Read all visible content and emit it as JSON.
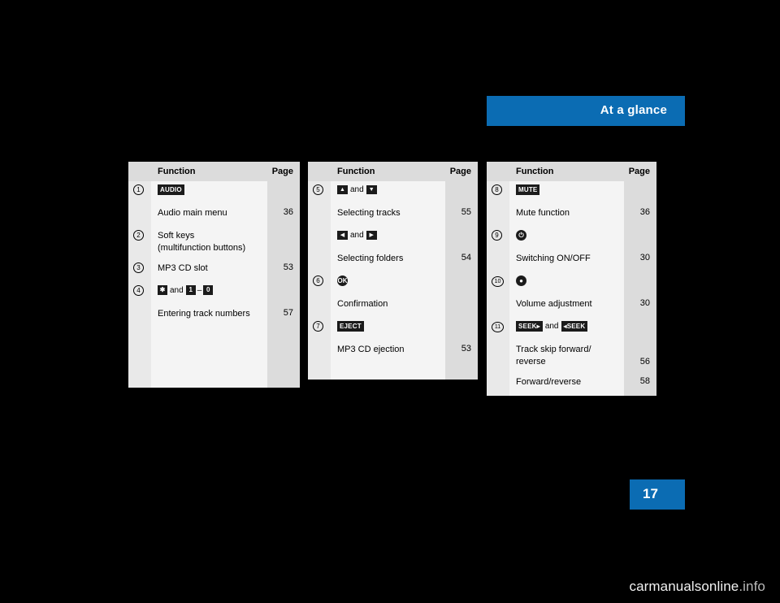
{
  "header": {
    "title": "At a glance",
    "accent_color": "#0b6cb3"
  },
  "page": {
    "number": "17",
    "background": "#000000"
  },
  "watermark": {
    "main": "carmanualsonline",
    "suffix": ".info"
  },
  "tables": [
    {
      "id": "table-1",
      "head": {
        "function": "Function",
        "page": "Page"
      },
      "rows": [
        {
          "num": "1",
          "lines": [
            {
              "type": "key",
              "key": "AUDIO"
            }
          ],
          "page": ""
        },
        {
          "num": "",
          "lines": [
            {
              "type": "text",
              "text": "Audio main menu"
            }
          ],
          "page": "36"
        },
        {
          "num": "2",
          "lines": [
            {
              "type": "text",
              "text": "Soft keys"
            },
            {
              "type": "text",
              "text": "(multifunction buttons)"
            }
          ],
          "page": ""
        },
        {
          "num": "3",
          "lines": [
            {
              "type": "text",
              "text": "MP3 CD slot"
            }
          ],
          "page": "53"
        },
        {
          "num": "4",
          "lines": [
            {
              "type": "keys",
              "a": "✱",
              "join": "and",
              "b": "1",
              "dash": "–",
              "c": "0"
            }
          ],
          "page": ""
        },
        {
          "num": "",
          "lines": [
            {
              "type": "text",
              "text": "Entering track numbers"
            }
          ],
          "page": "57"
        }
      ]
    },
    {
      "id": "table-2",
      "head": {
        "function": "Function",
        "page": "Page"
      },
      "rows": [
        {
          "num": "5",
          "lines": [
            {
              "type": "keys",
              "a": "▲",
              "join": "and",
              "b": "▼"
            }
          ],
          "page": ""
        },
        {
          "num": "",
          "lines": [
            {
              "type": "text",
              "text": "Selecting tracks"
            }
          ],
          "page": "55"
        },
        {
          "num": "",
          "lines": [
            {
              "type": "keys",
              "a": "◀",
              "join": "and",
              "b": "▶"
            }
          ],
          "page": ""
        },
        {
          "num": "",
          "lines": [
            {
              "type": "text",
              "text": "Selecting folders"
            }
          ],
          "page": "54"
        },
        {
          "num": "6",
          "lines": [
            {
              "type": "key-round",
              "key": "OK"
            }
          ],
          "page": ""
        },
        {
          "num": "",
          "lines": [
            {
              "type": "text",
              "text": "Confirmation"
            }
          ],
          "page": ""
        },
        {
          "num": "7",
          "lines": [
            {
              "type": "key",
              "key": "EJECT"
            }
          ],
          "page": ""
        },
        {
          "num": "",
          "lines": [
            {
              "type": "text",
              "text": "MP3 CD ejection"
            }
          ],
          "page": "53"
        }
      ]
    },
    {
      "id": "table-3",
      "head": {
        "function": "Function",
        "page": "Page"
      },
      "rows": [
        {
          "num": "8",
          "lines": [
            {
              "type": "key",
              "key": "MUTE"
            }
          ],
          "page": ""
        },
        {
          "num": "",
          "lines": [
            {
              "type": "text",
              "text": "Mute function"
            }
          ],
          "page": "36"
        },
        {
          "num": "9",
          "lines": [
            {
              "type": "key-round",
              "key": "⏻"
            }
          ],
          "page": ""
        },
        {
          "num": "",
          "lines": [
            {
              "type": "text",
              "text": "Switching ON/OFF"
            }
          ],
          "page": "30"
        },
        {
          "num": "10",
          "lines": [
            {
              "type": "key-round",
              "key": "●"
            }
          ],
          "page": ""
        },
        {
          "num": "",
          "lines": [
            {
              "type": "text",
              "text": "Volume adjustment"
            }
          ],
          "page": "30"
        },
        {
          "num": "11",
          "lines": [
            {
              "type": "keys",
              "a": "SEEK▸",
              "join": "and",
              "b": "◂SEEK"
            }
          ],
          "page": ""
        },
        {
          "num": "",
          "lines": [
            {
              "type": "text",
              "text": "Track skip forward/"
            },
            {
              "type": "text",
              "text": "reverse"
            }
          ],
          "page": "56"
        },
        {
          "num": "",
          "lines": [
            {
              "type": "text",
              "text": "Forward/reverse"
            }
          ],
          "page": "58"
        }
      ]
    }
  ]
}
